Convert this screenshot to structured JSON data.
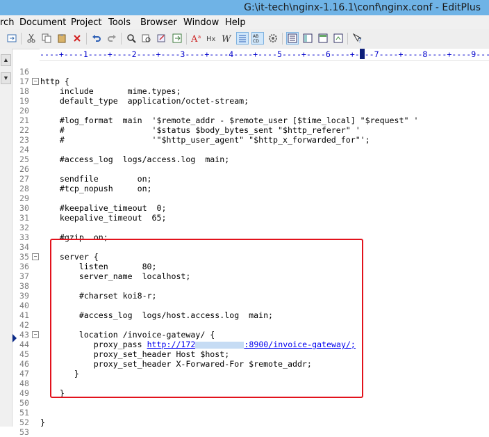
{
  "window": {
    "title": "G:\\it-tech\\nginx-1.16.1\\conf\\nginx.conf - EditPlus"
  },
  "menu": [
    "rch",
    "Document",
    "Project",
    "Tools",
    "Browser",
    "Window",
    "Help"
  ],
  "ruler": "----+----1----+----2----+----3----+----4----+----5----+----6----+----7----+----8----+----9---",
  "toolbar_icons": [
    "view-icon",
    "cut-icon",
    "copy-icon",
    "paste-icon",
    "delete-icon",
    "undo-icon",
    "redo-icon",
    "find-icon",
    "find-replace-icon",
    "replace-icon",
    "goto-icon",
    "font-size-icon",
    "hex-icon",
    "word-wrap-icon",
    "line-numbers-icon",
    "spell-check-icon",
    "settings-icon",
    "document-list-icon",
    "clip-text-icon",
    "directory-icon",
    "browser-icon",
    "help-icon"
  ],
  "lines": [
    {
      "num": "16",
      "text": ""
    },
    {
      "num": "17",
      "text": "http {",
      "fold": "−"
    },
    {
      "num": "18",
      "text": "    include       mime.types;"
    },
    {
      "num": "19",
      "text": "    default_type  application/octet-stream;"
    },
    {
      "num": "20",
      "text": ""
    },
    {
      "num": "21",
      "text": "    #log_format  main  '$remote_addr - $remote_user [$time_local] \"$request\" '"
    },
    {
      "num": "22",
      "text": "    #                  '$status $body_bytes_sent \"$http_referer\" '"
    },
    {
      "num": "23",
      "text": "    #                  '\"$http_user_agent\" \"$http_x_forwarded_for\"';"
    },
    {
      "num": "24",
      "text": ""
    },
    {
      "num": "25",
      "text": "    #access_log  logs/access.log  main;"
    },
    {
      "num": "26",
      "text": ""
    },
    {
      "num": "27",
      "text": "    sendfile        on;"
    },
    {
      "num": "28",
      "text": "    #tcp_nopush     on;"
    },
    {
      "num": "29",
      "text": ""
    },
    {
      "num": "30",
      "text": "    #keepalive_timeout  0;"
    },
    {
      "num": "31",
      "text": "    keepalive_timeout  65;"
    },
    {
      "num": "32",
      "text": ""
    },
    {
      "num": "33",
      "text": "    #gzip  on;"
    },
    {
      "num": "34",
      "text": ""
    },
    {
      "num": "35",
      "text": "    server {",
      "fold": "−"
    },
    {
      "num": "36",
      "text": "        listen       80;"
    },
    {
      "num": "37",
      "text": "        server_name  localhost;"
    },
    {
      "num": "38",
      "text": ""
    },
    {
      "num": "39",
      "text": "        #charset koi8-r;"
    },
    {
      "num": "40",
      "text": ""
    },
    {
      "num": "41",
      "text": "        #access_log  logs/host.access.log  main;"
    },
    {
      "num": "42",
      "text": ""
    },
    {
      "num": "43",
      "text": "        location /invoice-gateway/ {",
      "fold": "−"
    },
    {
      "num": "44",
      "text": "           proxy_pass ",
      "url_pre": "http://172",
      "url_post": ":8900/invoice-gateway/;"
    },
    {
      "num": "45",
      "text": "           proxy_set_header Host $host;"
    },
    {
      "num": "46",
      "text": "           proxy_set_header X-Forwared-For $remote_addr;"
    },
    {
      "num": "47",
      "text": "       }"
    },
    {
      "num": "48",
      "text": ""
    },
    {
      "num": "49",
      "text": "    }"
    },
    {
      "num": "50",
      "text": ""
    },
    {
      "num": "51",
      "text": ""
    },
    {
      "num": "52",
      "text": "}"
    },
    {
      "num": "53",
      "text": ""
    }
  ],
  "colors": {
    "titlebar": "#6fb3e6",
    "highlight_box": "#e2121c",
    "url": "#0000ee",
    "ruler": "#0000cc"
  }
}
